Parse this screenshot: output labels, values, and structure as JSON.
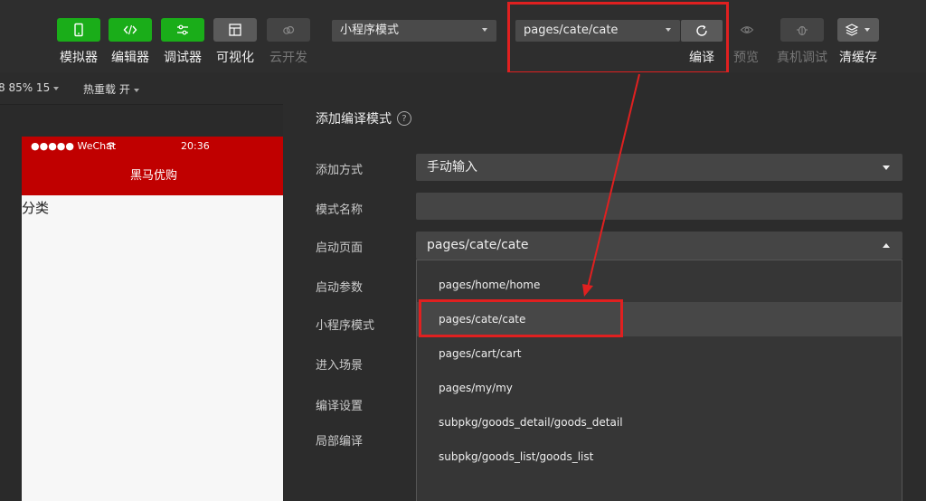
{
  "toolbar": {
    "buttons": [
      {
        "label": "模拟器",
        "icon": "phone-icon"
      },
      {
        "label": "编辑器",
        "icon": "code-icon"
      },
      {
        "label": "调试器",
        "icon": "sliders-icon"
      },
      {
        "label": "可视化",
        "icon": "layout-icon"
      },
      {
        "label": "云开发",
        "icon": "cloud-icon"
      }
    ],
    "mode_select": "小程序模式",
    "page_select": "pages/cate/cate",
    "compile_label": "编译",
    "preview_label": "预览",
    "remote_debug_label": "真机调试",
    "clear_cache_label": "清缓存"
  },
  "subbar": {
    "zoom": "8 85% 15",
    "hot_reload": "热重载 开"
  },
  "phone": {
    "carrier": "●●●●● WeChat",
    "time": "20:36",
    "nav_title": "黑马优购",
    "content": "分类"
  },
  "dialog": {
    "title": "添加编译模式",
    "fields": {
      "add_method_label": "添加方式",
      "add_method_value": "手动输入",
      "mode_name_label": "模式名称",
      "start_page_label": "启动页面",
      "start_page_value": "pages/cate/cate",
      "start_params_label": "启动参数",
      "mp_mode_label": "小程序模式",
      "scene_label": "进入场景",
      "compile_settings_label": "编译设置",
      "partial_compile_label": "局部编译"
    },
    "dropdown": [
      "pages/home/home",
      "pages/cate/cate",
      "pages/cart/cart",
      "pages/my/my",
      "subpkg/goods_detail/goods_detail",
      "subpkg/goods_list/goods_list"
    ]
  },
  "colors": {
    "accent_green": "#1aad19",
    "annotation_red": "#e02020",
    "phone_header": "#c00000"
  }
}
